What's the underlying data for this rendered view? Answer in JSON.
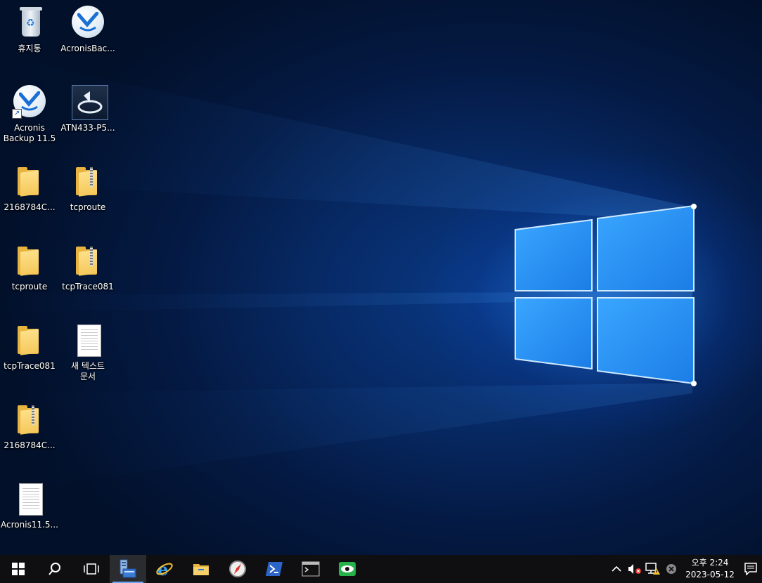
{
  "desktop": {
    "icons": [
      {
        "label": "휴지통",
        "kind": "recycle-bin"
      },
      {
        "label": "AcronisBac...",
        "kind": "acronis"
      },
      {
        "label": "Acronis\nBackup 11.5",
        "kind": "acronis-shortcut"
      },
      {
        "label": "ATN433-P5...",
        "kind": "installer"
      },
      {
        "label": "2168784C...",
        "kind": "folder"
      },
      {
        "label": "tcproute",
        "kind": "zip-folder"
      },
      {
        "label": "tcproute",
        "kind": "folder"
      },
      {
        "label": "tcpTrace081",
        "kind": "zip-folder"
      },
      {
        "label": "tcpTrace081",
        "kind": "folder"
      },
      {
        "label": "새 텍스트\n문서",
        "kind": "text-document"
      },
      {
        "label": "2168784C...",
        "kind": "zip-folder"
      },
      {
        "label": "Acronis11.5...",
        "kind": "text-document"
      }
    ]
  },
  "taskbar": {
    "buttons": [
      {
        "name": "start-button",
        "icon": "windows-logo-icon"
      },
      {
        "name": "search-button",
        "icon": "search-icon"
      },
      {
        "name": "task-view-button",
        "icon": "task-view-icon"
      },
      {
        "name": "server-manager-button",
        "icon": "server-manager-icon",
        "active": true
      },
      {
        "name": "internet-explorer-button",
        "icon": "internet-explorer-icon"
      },
      {
        "name": "file-explorer-button",
        "icon": "folder-icon"
      },
      {
        "name": "compass-app-button",
        "icon": "compass-icon"
      },
      {
        "name": "powershell-button",
        "icon": "powershell-icon"
      },
      {
        "name": "command-prompt-button",
        "icon": "cmd-icon"
      },
      {
        "name": "remote-viewer-button",
        "icon": "eye-icon"
      }
    ],
    "tray": {
      "icons": [
        "chevron-up-icon",
        "volume-muted-icon",
        "network-warning-icon",
        "close-circle-icon"
      ],
      "time": "오후 2:24",
      "date": "2023-05-12"
    }
  },
  "colors": {
    "accent": "#6aa7ee",
    "taskbar": "#0f0f11",
    "folder": "#f5c85a"
  }
}
